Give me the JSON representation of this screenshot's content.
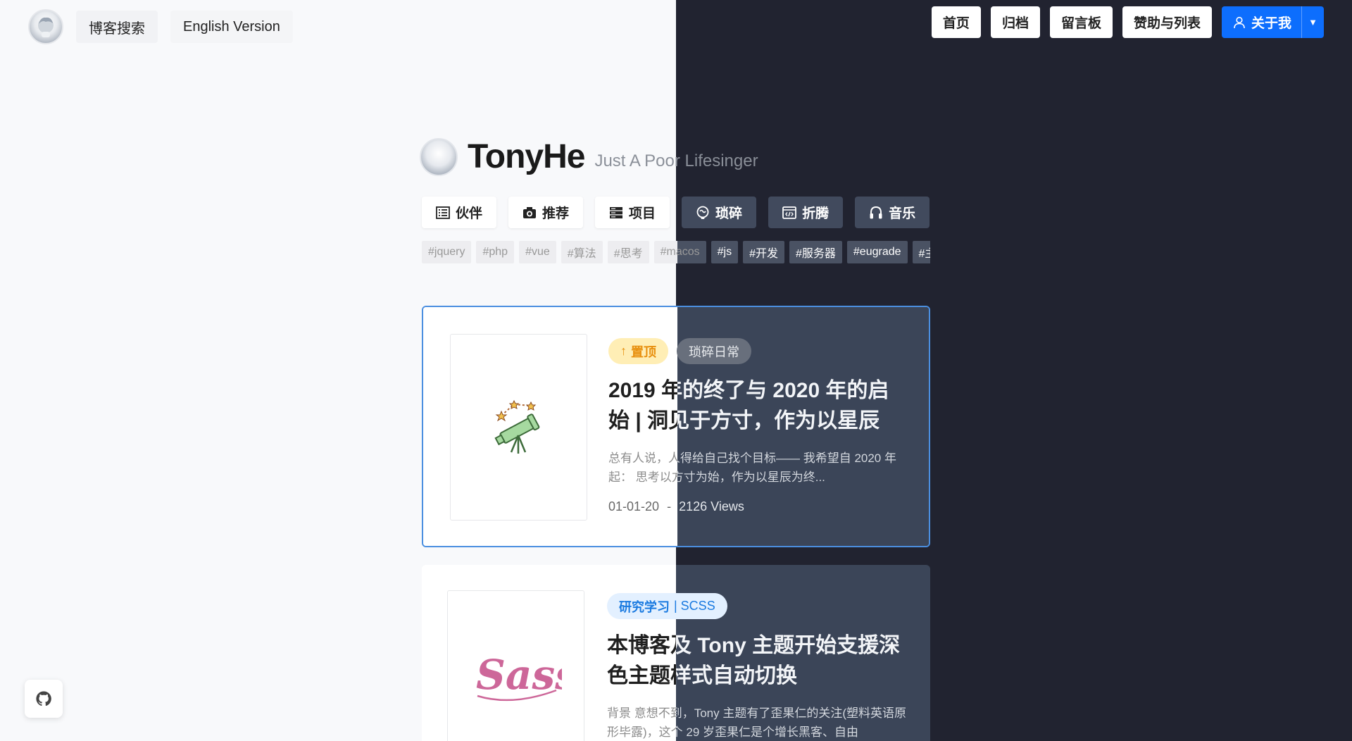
{
  "colors": {
    "light_bg": "#f8f9fb",
    "dark_bg": "#212330",
    "accent_blue": "#0d6efd",
    "pin_badge": "#ffeeb5",
    "card_border": "#4b8fe0"
  },
  "header_left": {
    "search_label": "博客搜索",
    "english_label": "English Version"
  },
  "nav": {
    "items": [
      "首页",
      "归档",
      "留言板",
      "赞助与列表"
    ],
    "about": "关于我"
  },
  "brand": {
    "name": "TonyHe",
    "tagline": "Just A Poor Lifesinger"
  },
  "categories": [
    {
      "label": "伙伴",
      "icon": "list-icon"
    },
    {
      "label": "推荐",
      "icon": "camera-icon"
    },
    {
      "label": "项目",
      "icon": "server-icon"
    },
    {
      "label": "琐碎",
      "icon": "brain-icon"
    },
    {
      "label": "折腾",
      "icon": "code-window-icon"
    },
    {
      "label": "音乐",
      "icon": "headphones-icon"
    }
  ],
  "tags": [
    "#jquery",
    "#php",
    "#vue",
    "#算法",
    "#思考",
    "#macos",
    "#js",
    "#开发",
    "#服务器",
    "#eugrade",
    "#主题"
  ],
  "posts": [
    {
      "pin_label": "置顶",
      "category": "琐碎日常",
      "title": "2019 年的终了与 2020 年的启始 | 洞见于方寸，作为以星辰",
      "excerpt": "总有人说，人得给自己找个目标—— 我希望自 2020 年起： 思考以方寸为始，作为以星辰为终...",
      "date": "01-01-20",
      "separator": "-",
      "views": "2126 Views",
      "thumb_icon": "telescope-icon"
    },
    {
      "category_main": "研究学习",
      "category_sub": "| SCSS",
      "title": "本博客及 Tony 主题开始支援深色主题样式自动切换",
      "excerpt": "背景 意想不到，Tony 主题有了歪果仁的关注(塑料英语原形毕露)，这个 29 岁歪果仁是个增长黑客、自由",
      "thumb_icon": "sass-logo"
    }
  ]
}
